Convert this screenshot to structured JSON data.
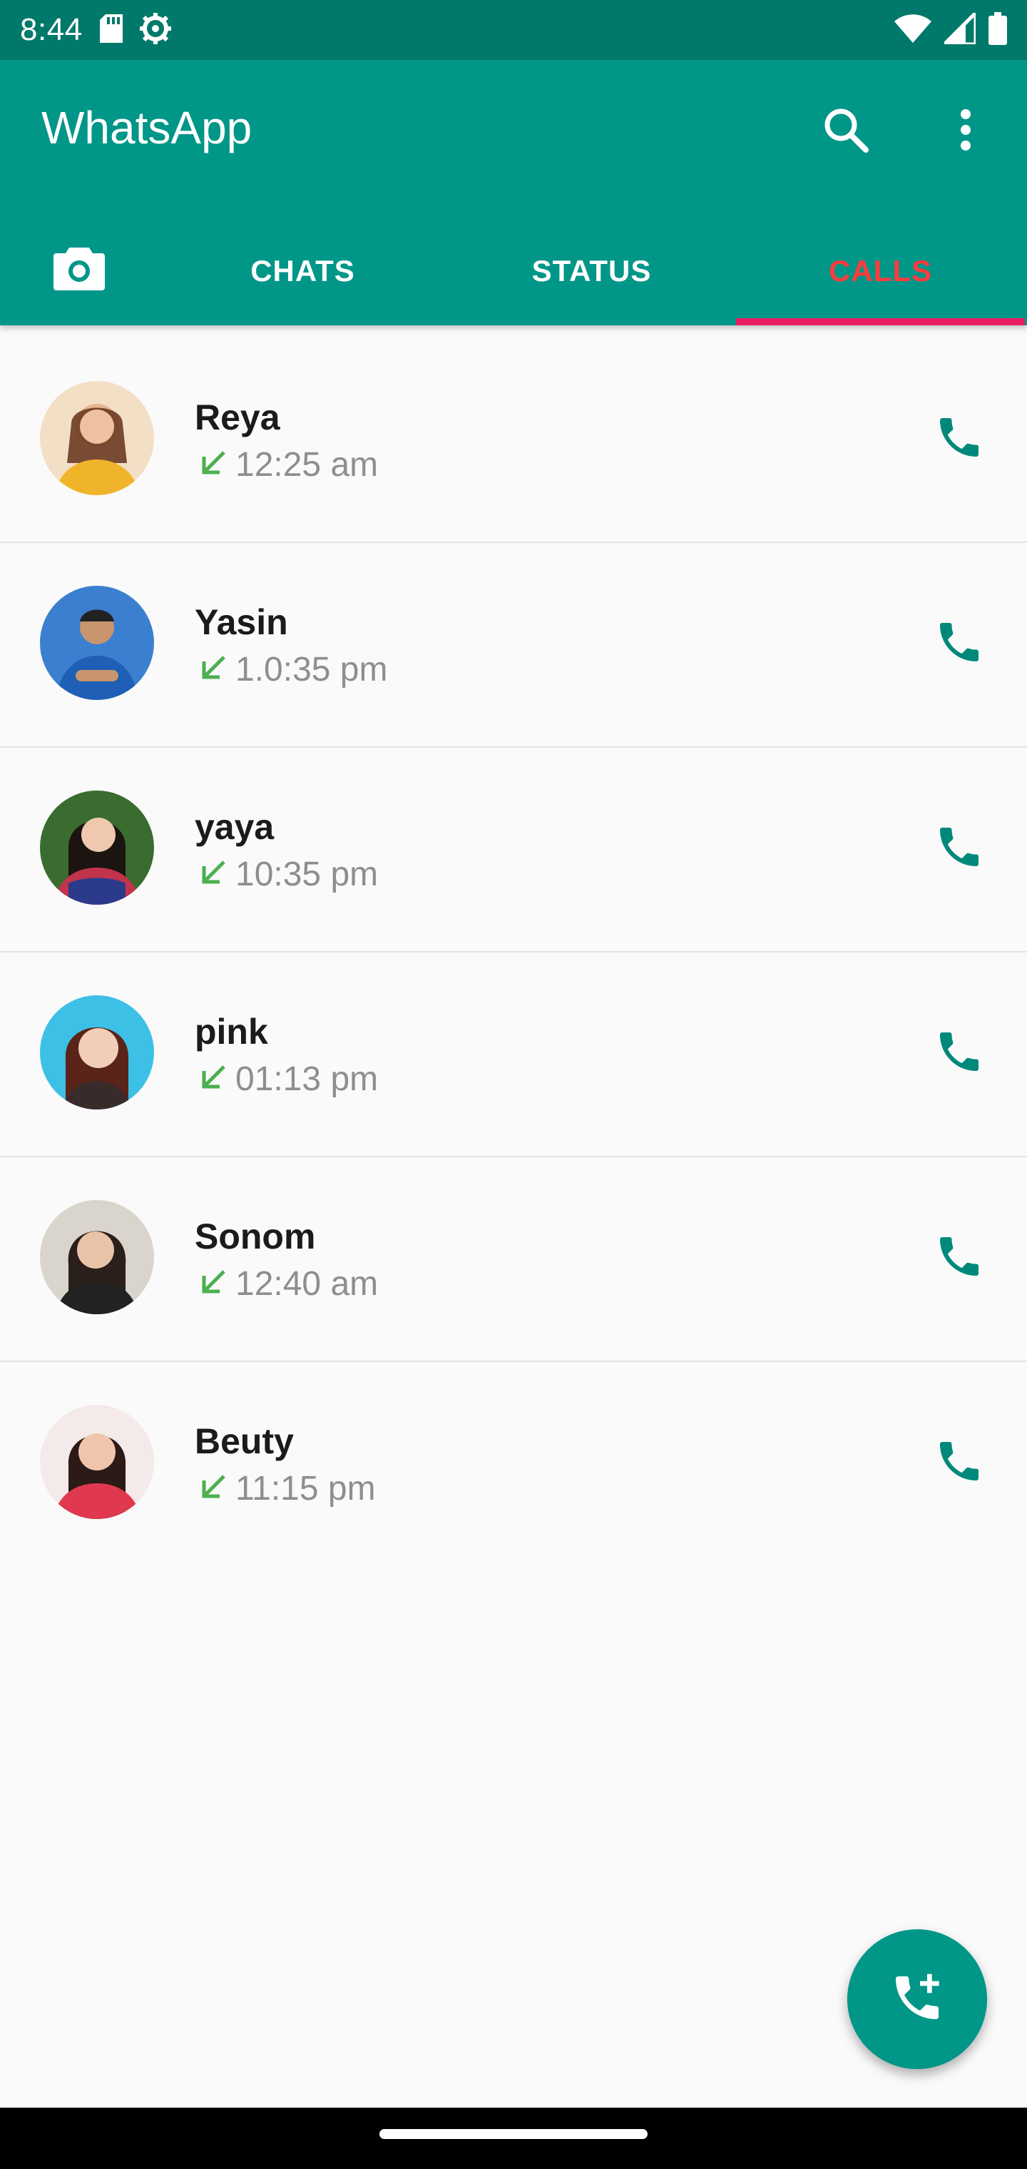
{
  "status_bar": {
    "time": "8:44",
    "icons": [
      "sd-card-icon",
      "settings-gear-icon",
      "wifi-icon",
      "signal-icon",
      "battery-icon"
    ]
  },
  "app_bar": {
    "title": "WhatsApp",
    "actions": [
      "search-icon",
      "more-vert-icon"
    ]
  },
  "tabs": [
    {
      "label": "",
      "icon": "camera-icon",
      "active": false
    },
    {
      "label": "CHATS",
      "active": false
    },
    {
      "label": "STATUS",
      "active": false
    },
    {
      "label": "CALLS",
      "active": true
    }
  ],
  "calls": [
    {
      "name": "Reya",
      "time": "12:25 am",
      "direction": "incoming"
    },
    {
      "name": "Yasin",
      "time": "1.0:35 pm",
      "direction": "incoming"
    },
    {
      "name": "yaya",
      "time": "10:35 pm",
      "direction": "incoming"
    },
    {
      "name": "pink",
      "time": "01:13 pm",
      "direction": "incoming"
    },
    {
      "name": "Sonom",
      "time": "12:40 am",
      "direction": "incoming"
    },
    {
      "name": "Beuty",
      "time": "11:15 pm",
      "direction": "incoming"
    }
  ],
  "fab": {
    "icon": "add-call-icon"
  },
  "colors": {
    "primary": "#009688",
    "primary_dark": "#00796b",
    "accent": "#e91e63",
    "active_tab_text": "#ff3b3b",
    "call_icon": "#00897b",
    "incoming_arrow": "#4caf50"
  }
}
